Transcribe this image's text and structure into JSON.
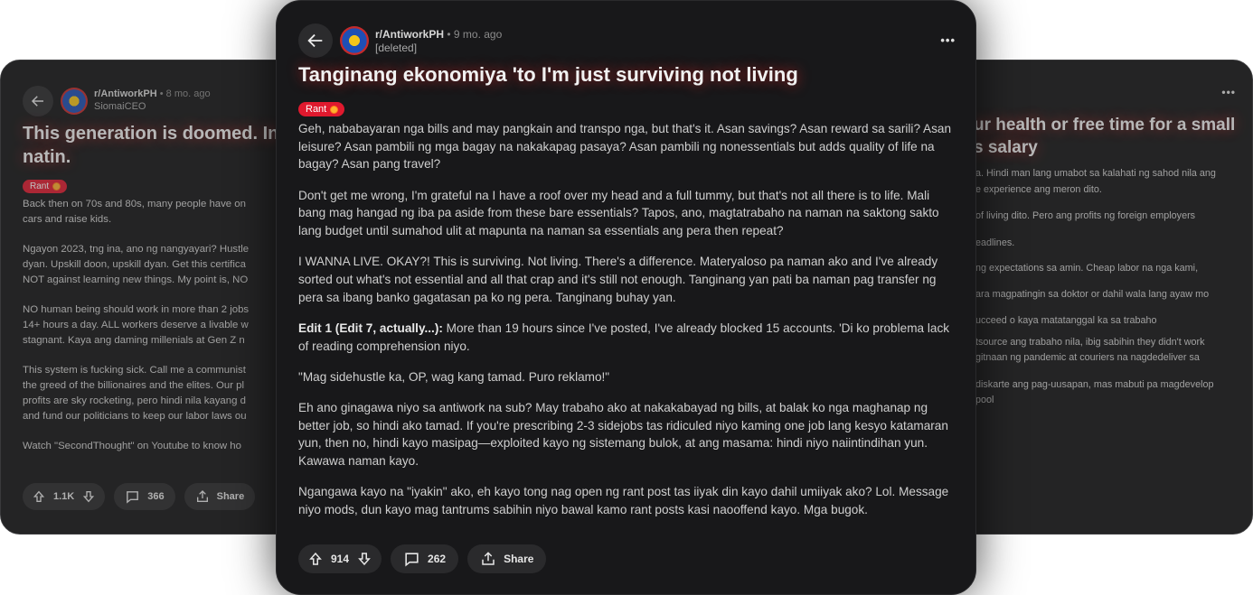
{
  "main_post": {
    "subreddit": "r/AntiworkPH",
    "age": "• 9 mo. ago",
    "author": "[deleted]",
    "more_label": "•••",
    "title": "Tanginang ekonomiya 'to I'm just surviving not living",
    "flair": "Rant",
    "paragraphs": [
      "Geh, nababayaran nga bills and may pangkain and transpo nga, but that's it. Asan savings? Asan reward sa sarili? Asan leisure? Asan pambili ng mga bagay na nakakapag pasaya? Asan pambili ng nonessentials but adds quality of life na bagay? Asan pang travel?",
      "Don't get me wrong, I'm grateful na I have a roof over my head and a full tummy, but that's not all there is to life. Mali bang mag hangad ng iba pa aside from these bare essentials? Tapos, ano, magtatrabaho na naman na saktong sakto lang budget until sumahod ulit at mapunta na naman sa essentials ang pera then repeat?",
      "I WANNA LIVE. OKAY?! This is surviving. Not living. There's a difference. Materyaloso pa naman ako and I've already sorted out what's not essential and all that crap and it's still not enough. Tanginang yan pati ba naman pag transfer ng pera sa ibang banko gagatasan pa ko ng pera. Tanginang buhay yan."
    ],
    "edit_label": "Edit 1 (Edit 7, actually...):",
    "edit_text": " More than 19 hours since I've posted, I've already blocked 15 accounts. 'Di ko problema lack of reading comprehension niyo.",
    "paragraphs_after": [
      "\"Mag sidehustle ka, OP, wag kang tamad. Puro reklamo!\"",
      "Eh ano ginagawa niyo sa antiwork na sub? May trabaho ako at nakakabayad ng bills, at balak ko nga maghanap ng better job, so hindi ako tamad. If you're prescribing 2-3 sidejobs tas ridiculed niyo kaming one job lang kesyo katamaran yun, then no, hindi kayo masipag—exploited kayo ng sistemang bulok, at ang masama: hindi niyo naiintindihan yun. Kawawa naman kayo.",
      "Ngangawa kayo na \"iyakin\" ako, eh kayo tong nag open ng rant post tas iiyak din kayo dahil umiiyak ako? Lol. Message niyo mods, dun kayo mag tantrums sabihin niyo bawal kamo rant posts kasi naooffend kayo. Mga bugok."
    ],
    "votes": "914",
    "comments": "262",
    "share_label": "Share"
  },
  "left_post": {
    "subreddit": "r/AntiworkPH",
    "age": "• 8 mo. ago",
    "author": "SiomaiCEO",
    "title_line1": "This generation is doomed. In",
    "title_line2": "natin.",
    "flair": "Rant",
    "lines": [
      [
        "Back then on 70s and 80s, many people have on",
        "cars and raise kids."
      ],
      [
        "Ngayon 2023, tng ina, ano ng nangyayari? Hustle",
        "dyan. Upskill doon, upskill dyan. Get this certifica",
        "NOT against learning new things. My point is, NO"
      ],
      [
        "NO human being should work in more than 2 jobs",
        "14+ hours a day. ALL workers deserve a livable w",
        "stagnant. Kaya ang daming millenials at Gen Z n"
      ],
      [
        "This system is fucking sick. Call me a communist",
        "the greed of the billionaires and the elites. Our pl",
        "profits are sky rocketing, pero hindi nila kayang d",
        "and fund our politicians to keep our labor laws ou"
      ],
      [
        "Watch \"SecondThought\" on Youtube to know ho"
      ]
    ],
    "votes": "1.1K",
    "comments": "366",
    "share_label": "Share"
  },
  "right_post": {
    "more_label": "•••",
    "title_line1": "ur health or free time for a small",
    "title_line2": "s salary",
    "lines": [
      "a. Hindi man lang umabot sa kalahati ng sahod nila ang",
      "e experience ang meron dito.",
      "",
      "of living dito. Pero ang profits ng foreign employers",
      "",
      "",
      "eadlines.",
      "",
      "ng expectations sa amin. Cheap labor na nga kami,",
      "",
      "",
      "ara magpatingin sa doktor or dahil wala lang ayaw mo",
      "",
      "",
      "ucceed o kaya matatanggal ka sa trabaho",
      "",
      "tsource ang trabaho nila, ibig sabihin they didn't work",
      "gitnaan ng pandemic at couriers na nagdedeliver sa",
      "",
      "",
      "diskarte ang pag-uusapan, mas mabuti pa magdevelop",
      "pool"
    ]
  }
}
